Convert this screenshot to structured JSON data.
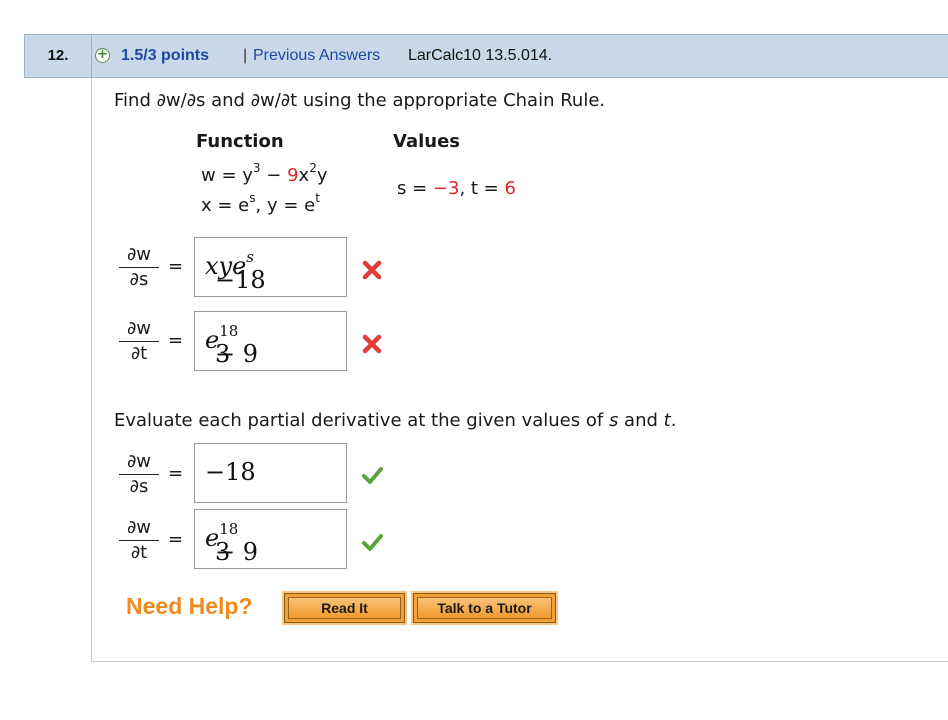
{
  "header": {
    "question_number": "12.",
    "plus_icon": "+",
    "points": "1.5/3 points",
    "separator": "|",
    "previous_answers": "Previous Answers",
    "source": "LarCalc10 13.5.014."
  },
  "prompt": "Find ∂w/∂s and ∂w/∂t using the appropriate Chain Rule.",
  "table": {
    "function_header": "Function",
    "values_header": "Values",
    "w_eq_prefix": "w = y",
    "w_eq_exp1": "3",
    "w_eq_minus": " − ",
    "w_eq_coef": "9",
    "w_eq_x": "x",
    "w_eq_exp2": "2",
    "w_eq_y": "y",
    "xy_x": "x = e",
    "xy_x_exp": "s",
    "xy_sep": ",  y = e",
    "xy_y_exp": "t",
    "values_s": "s = ",
    "values_s_val": "−3",
    "values_comma": ",  t = ",
    "values_t_val": "6"
  },
  "part1": {
    "dw": "∂w",
    "ds": "∂s",
    "dt": "∂t",
    "equals": "=",
    "ans_s_prefix": "−18",
    "ans_s_var": "xye",
    "ans_s_exp": "s",
    "ans_t_base": "3",
    "ans_t_var": "e",
    "ans_t_exp": "18",
    "ans_t_tail": " − 9"
  },
  "evaluate_prompt_a": "Evaluate each partial derivative at the given values of ",
  "evaluate_prompt_s": "s",
  "evaluate_prompt_and": " and ",
  "evaluate_prompt_t": "t",
  "evaluate_prompt_end": ".",
  "part2": {
    "ans_s": "−18",
    "ans_t_base": "3",
    "ans_t_var": "e",
    "ans_t_exp": "18",
    "ans_t_tail": " − 9"
  },
  "help": {
    "label": "Need Help?",
    "read_it": "Read It",
    "talk_to_tutor": "Talk to a Tutor"
  },
  "icons": {
    "incorrect": "x-mark-icon",
    "correct": "check-mark-icon"
  },
  "colors": {
    "header_bg": "#c9d9ea",
    "link": "#1e48a5",
    "highlight": "#e0242c",
    "incorrect": "#e53a3a",
    "correct": "#5aa33c",
    "help": "#f08a1c",
    "button": "#f2a13a"
  }
}
